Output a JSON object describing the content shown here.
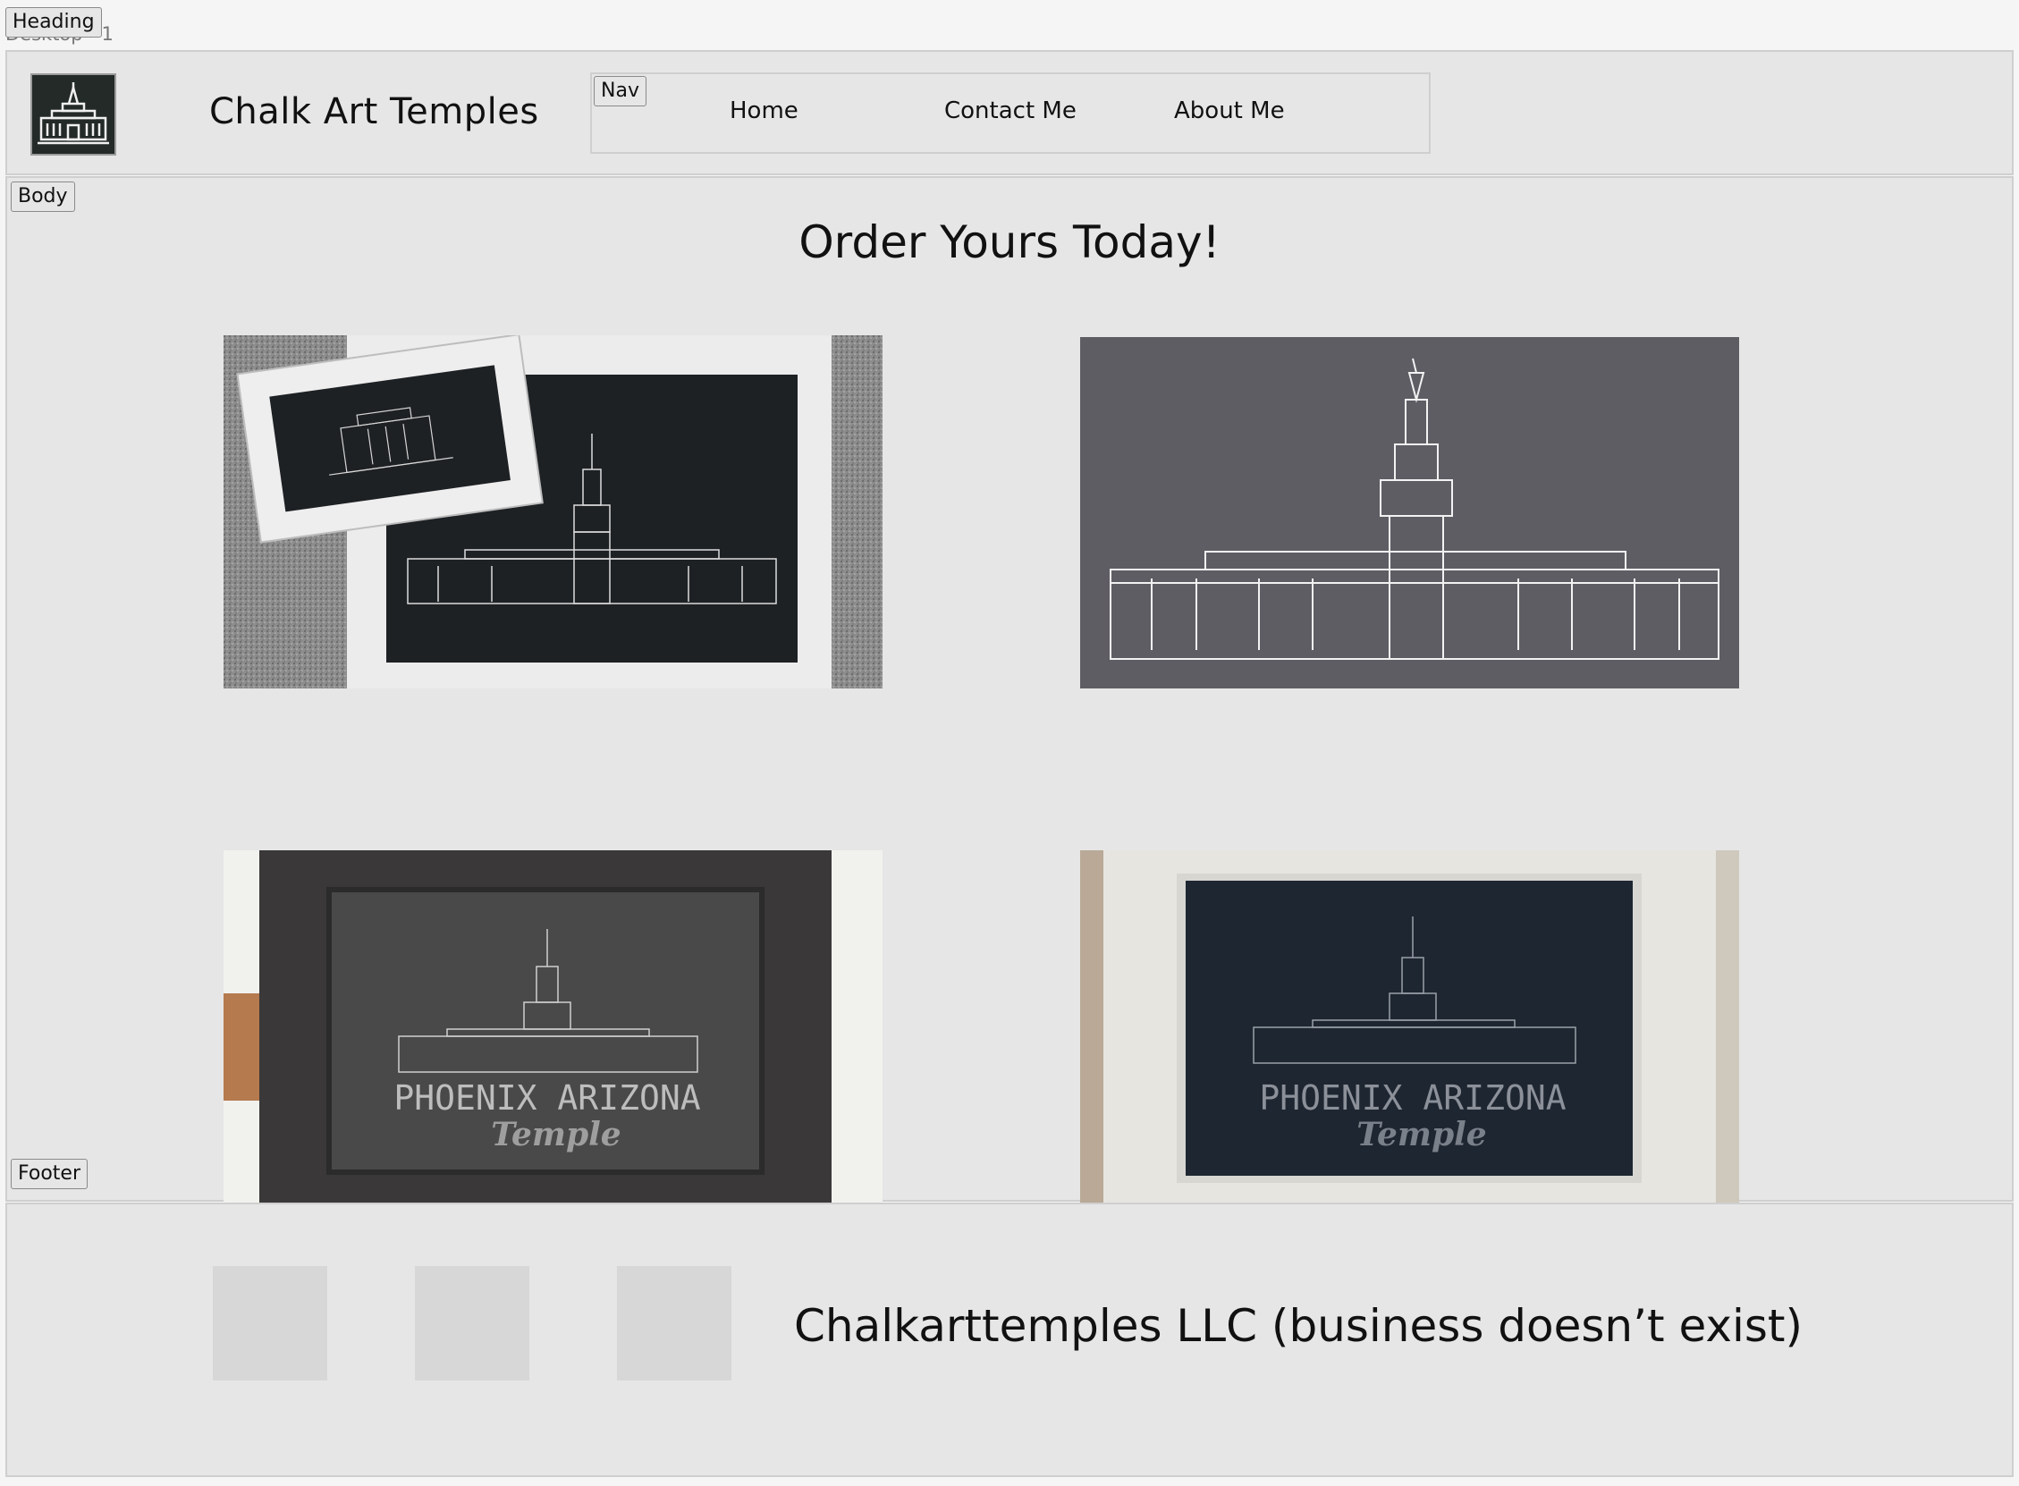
{
  "frame": {
    "tag": "Heading",
    "label": "Desktop - 1"
  },
  "header": {
    "site_title": "Chalk Art Temples",
    "logo_icon": "temple-logo-icon",
    "nav": {
      "tag": "Nav",
      "links": [
        "Home",
        "Contact Me",
        "About Me"
      ]
    }
  },
  "body": {
    "tag": "Body",
    "heading": "Order Yours Today!",
    "photos": [
      {
        "caption": ""
      },
      {
        "caption": ""
      },
      {
        "caption": "PHOENIX ARIZONA",
        "script": "Temple"
      },
      {
        "caption": "PHOENIX ARIZONA",
        "script": "Temple"
      }
    ]
  },
  "footer": {
    "tag": "Footer",
    "text": "Chalkarttemples LLC (business doesn’t exist)",
    "placeholders": 3
  },
  "colors": {
    "section_bg": "#e6e6e6",
    "page_bg": "#f5f5f5",
    "chalkboard": "#232a2c",
    "chalk_line": "#e8e8e8"
  }
}
